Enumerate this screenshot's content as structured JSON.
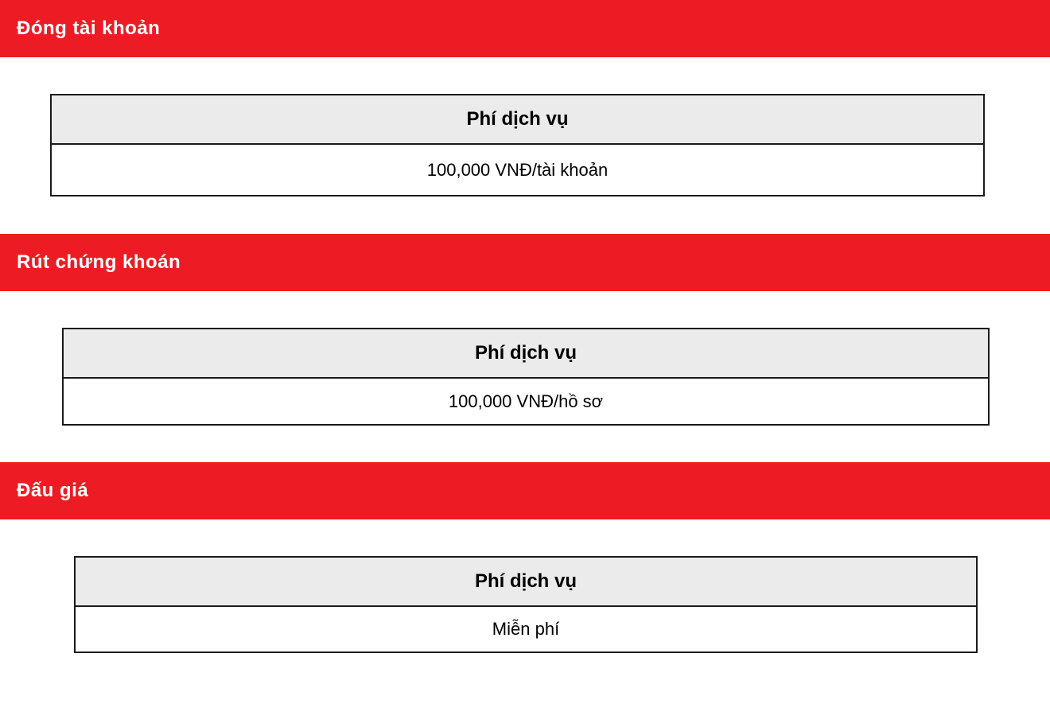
{
  "sections": [
    {
      "title": "Đóng tài khoản",
      "table": {
        "header": "Phí dịch vụ",
        "value": "100,000 VNĐ/tài khoản"
      }
    },
    {
      "title": "Rút chứng khoán",
      "table": {
        "header": "Phí dịch vụ",
        "value": "100,000 VNĐ/hồ sơ"
      }
    },
    {
      "title": "Đấu giá",
      "table": {
        "header": "Phí dịch vụ",
        "value": "Miễn phí"
      }
    }
  ],
  "colors": {
    "header_background": "#ed1c24",
    "header_text": "#ffffff",
    "table_header_background": "#ebebeb",
    "table_border": "#1a1a1a"
  }
}
